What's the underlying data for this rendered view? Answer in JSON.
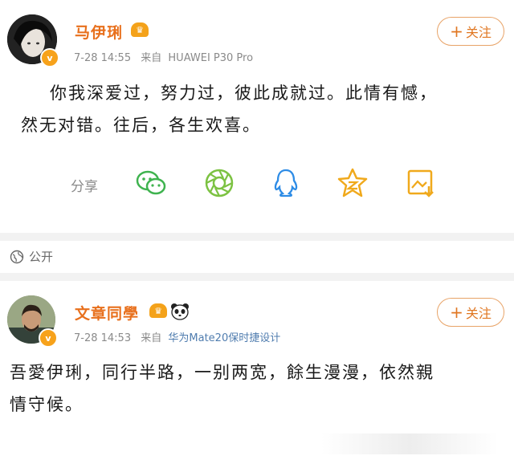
{
  "post1": {
    "author": "马伊琍",
    "time": "7-28 14:55",
    "source_prefix": "来自",
    "source": "HUAWEI P30 Pro",
    "follow_label": "关注",
    "body_lines": [
      "你我深爱过，努力过，彼此成就过。此情有憾，",
      "然无对错。往后，各生欢喜。"
    ],
    "share_label": "分享",
    "share_icons": [
      "wechat-icon",
      "moments-icon",
      "qq-icon",
      "qzone-icon",
      "save-image-icon"
    ]
  },
  "visibility": {
    "label": "公开",
    "icon": "globe-icon"
  },
  "post2": {
    "author": "文章同學",
    "time": "7-28 14:53",
    "source_prefix": "来自",
    "source": "华为Mate20保时捷设计",
    "follow_label": "关注",
    "body_lines": [
      "吾愛伊琍，同行半路，一别两宽，餘生漫漫，依然親",
      "情守候。"
    ]
  },
  "colors": {
    "accent": "#e8701d",
    "vip": "#f4a21a",
    "icon_green": "#3fb34f",
    "icon_blue": "#2e8ce6",
    "icon_gold": "#f0a91c"
  }
}
